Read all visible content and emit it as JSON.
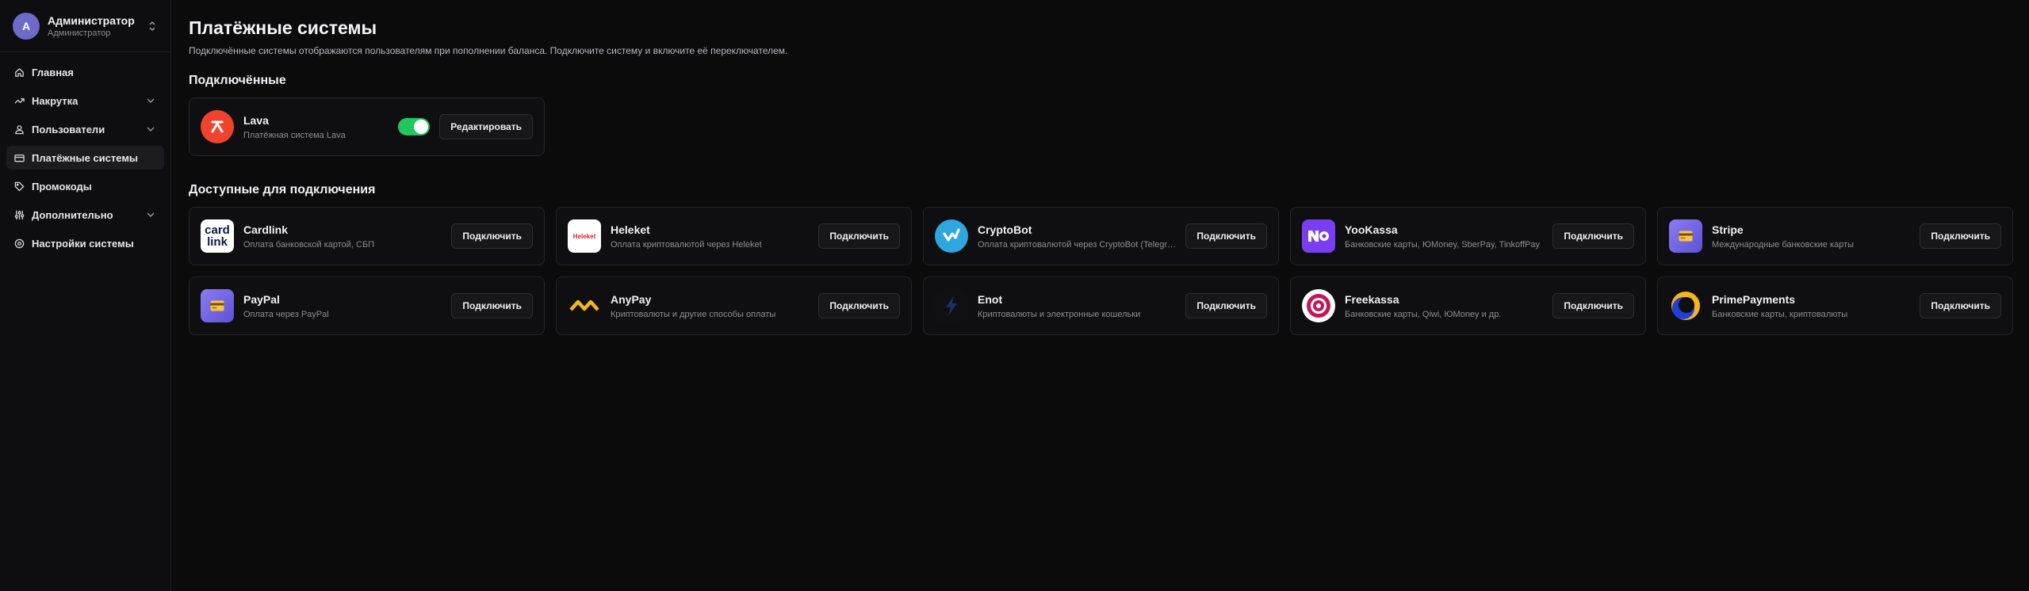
{
  "user": {
    "initial": "A",
    "name": "Администратор",
    "role": "Администратор"
  },
  "nav": [
    {
      "label": "Главная",
      "icon": "home-icon"
    },
    {
      "label": "Накрутка",
      "icon": "trending-icon"
    },
    {
      "label": "Пользователи",
      "icon": "users-icon"
    },
    {
      "label": "Платёжные системы",
      "icon": "credit-card-icon",
      "active": true
    },
    {
      "label": "Промокоды",
      "icon": "tag-icon"
    },
    {
      "label": "Дополнительно",
      "icon": "sliders-icon"
    },
    {
      "label": "Настройки системы",
      "icon": "settings-icon"
    }
  ],
  "page": {
    "title": "Платёжные системы",
    "description": "Подключённые системы отображаются пользователям при пополнении баланса. Подключите систему и включите её переключателем."
  },
  "connected": {
    "title": "Подключённые",
    "items": [
      {
        "name": "Lava",
        "description": "Платёжная система Lava",
        "enabled": true,
        "action": "Редактировать",
        "logo_color": "#f0432c"
      }
    ]
  },
  "available": {
    "title": "Доступные для подключения",
    "action": "Подключить",
    "items": [
      {
        "name": "Cardlink",
        "description": "Оплата банковской картой, СБП",
        "logo": "cardlink"
      },
      {
        "name": "Heleket",
        "description": "Оплата криптовалютой через Heleket",
        "logo": "heleket"
      },
      {
        "name": "CryptoBot",
        "description": "Оплата криптовалютой через CryptoBot (Telegram)",
        "logo": "cryptobot"
      },
      {
        "name": "YooKassa",
        "description": "Банковские карты, ЮMoney, SberPay, TinkoffPay",
        "logo": "yookassa"
      },
      {
        "name": "Stripe",
        "description": "Международные банковские карты",
        "logo": "stripe"
      },
      {
        "name": "PayPal",
        "description": "Оплата через PayPal",
        "logo": "paypal"
      },
      {
        "name": "AnyPay",
        "description": "Криптовалюты и другие способы оплаты",
        "logo": "anypay"
      },
      {
        "name": "Enot",
        "description": "Криптовалюты и электронные кошельки",
        "logo": "enot"
      },
      {
        "name": "Freekassa",
        "description": "Банковские карты, Qiwi, ЮMoney и др.",
        "logo": "freekassa"
      },
      {
        "name": "PrimePayments",
        "description": "Банковские карты, криптовалюты",
        "logo": "primepayments"
      }
    ]
  },
  "logo_texts": {
    "cardlink_top": "card",
    "cardlink_bottom": "link",
    "heleket": "Heleket"
  }
}
